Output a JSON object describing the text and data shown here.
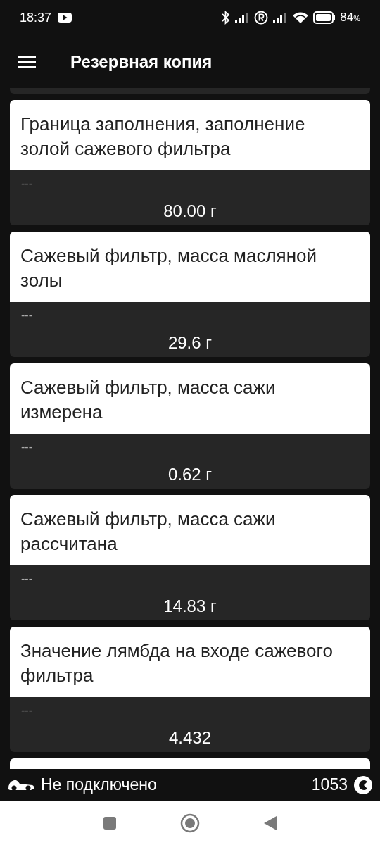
{
  "status_bar": {
    "time": "18:37",
    "battery": "84",
    "battery_unit": "%"
  },
  "app_bar": {
    "title": "Резервная копия"
  },
  "items": [
    {
      "name": "Граница заполнения, заполнение золой сажевого фильтра",
      "note": "---",
      "value": "80.00 г"
    },
    {
      "name": "Сажевый фильтр, масса масляной золы",
      "note": "---",
      "value": "29.6 г"
    },
    {
      "name": "Сажевый фильтр, масса сажи измерена",
      "note": "---",
      "value": "0.62 г"
    },
    {
      "name": "Сажевый фильтр, масса сажи рассчитана",
      "note": "---",
      "value": "14.83 г"
    },
    {
      "name": "Значение лямбда на входе сажевого фильтра",
      "note": "---",
      "value": "4.432"
    }
  ],
  "connection": {
    "status": "Не подключено",
    "count": "1053"
  }
}
